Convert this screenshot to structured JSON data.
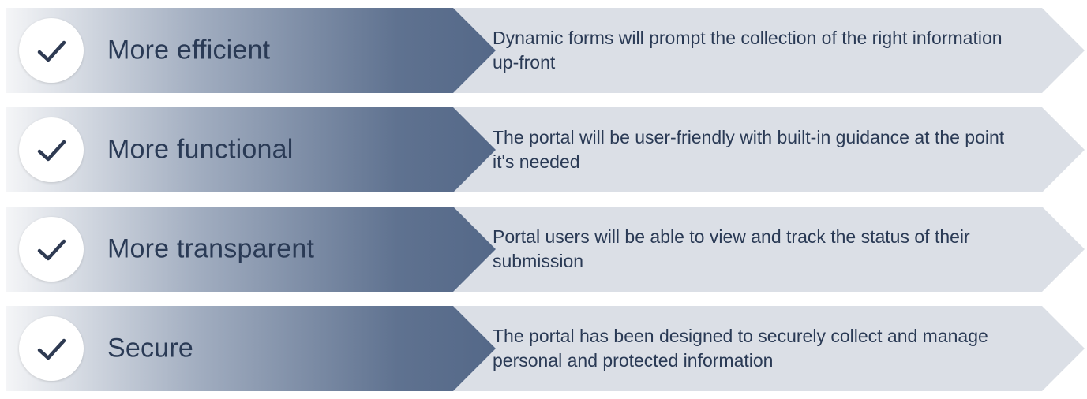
{
  "items": [
    {
      "title": "More efficient",
      "desc": "Dynamic forms will prompt the collection of the right information up-front"
    },
    {
      "title": "More functional",
      "desc": "The portal will be user-friendly with built-in guidance at the point it's needed"
    },
    {
      "title": "More transparent",
      "desc": "Portal users will be able to view and track the status of their submission"
    },
    {
      "title": "Secure",
      "desc": "The portal has been designed to securely collect and manage personal and protected information"
    }
  ]
}
